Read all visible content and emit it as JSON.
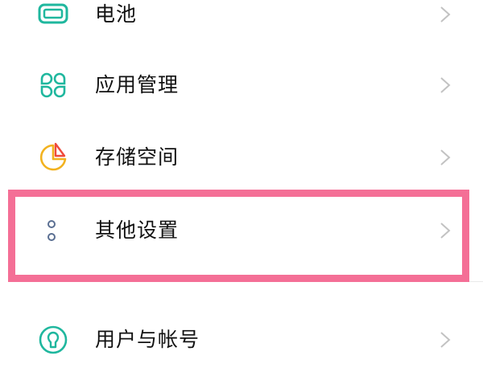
{
  "settings_list": {
    "items": [
      {
        "label": "电池",
        "icon": "battery-icon",
        "icon_color": "#1fb79e"
      },
      {
        "label": "应用管理",
        "icon": "apps-grid-icon",
        "icon_color": "#1fb79e"
      },
      {
        "label": "存储空间",
        "icon": "storage-pie-icon",
        "icon_colors": [
          "#f2b21f",
          "#ef4a3a"
        ]
      },
      {
        "label": "其他设置",
        "icon": "more-dots-icon",
        "icon_color": "#5a6f92"
      },
      {
        "label": "用户与帐号",
        "icon": "user-account-icon",
        "icon_color": "#1fb79e"
      }
    ],
    "chevron_icon": "chevron-right-icon",
    "highlight_color": "#f46f96"
  }
}
